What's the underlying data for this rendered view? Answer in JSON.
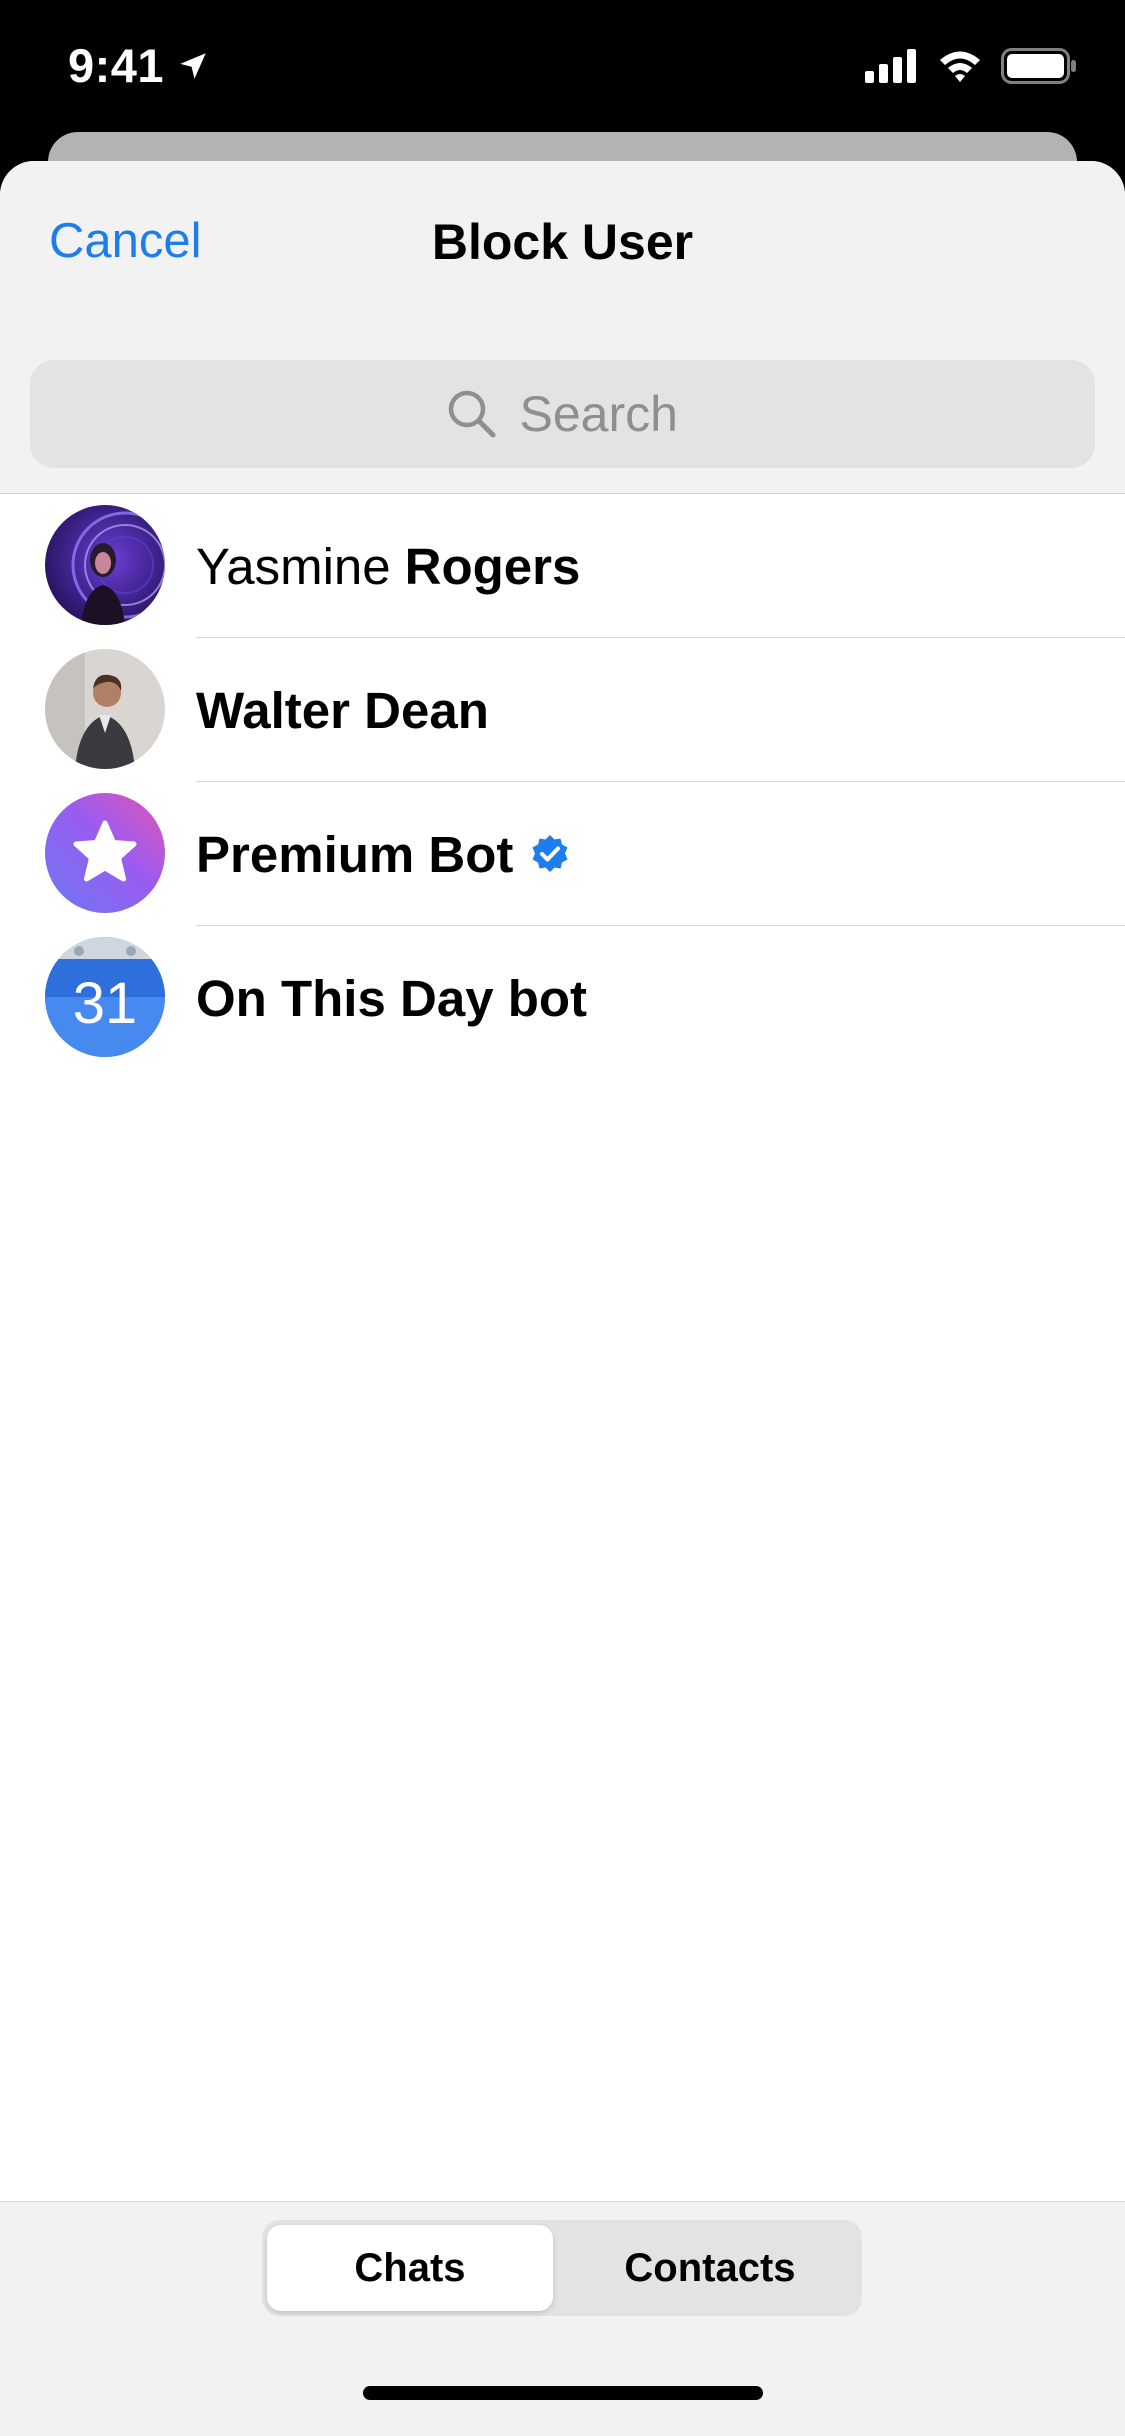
{
  "status_bar": {
    "time": "9:41",
    "location_icon": "location-arrow-icon",
    "signal_icon": "cellular-signal-icon",
    "wifi_icon": "wifi-icon",
    "battery_icon": "battery-icon"
  },
  "header": {
    "cancel_label": "Cancel",
    "title": "Block User"
  },
  "search": {
    "placeholder": "Search",
    "icon": "search-icon"
  },
  "contacts": [
    {
      "first": "Yasmine",
      "last": "Rogers",
      "avatar": "photo-avatar"
    },
    {
      "name": "Walter Dean",
      "avatar": "photo-avatar"
    },
    {
      "name": "Premium Bot",
      "verified": true,
      "avatar": "star-icon"
    },
    {
      "name": "On This Day bot",
      "avatar": "calendar-icon",
      "avatar_text": "31"
    }
  ],
  "segments": {
    "chats": "Chats",
    "contacts": "Contacts",
    "selected": "Chats"
  },
  "colors": {
    "accent": "#1d7ded",
    "verified": "#1d7ded",
    "header_bg": "#f2f2f2"
  }
}
